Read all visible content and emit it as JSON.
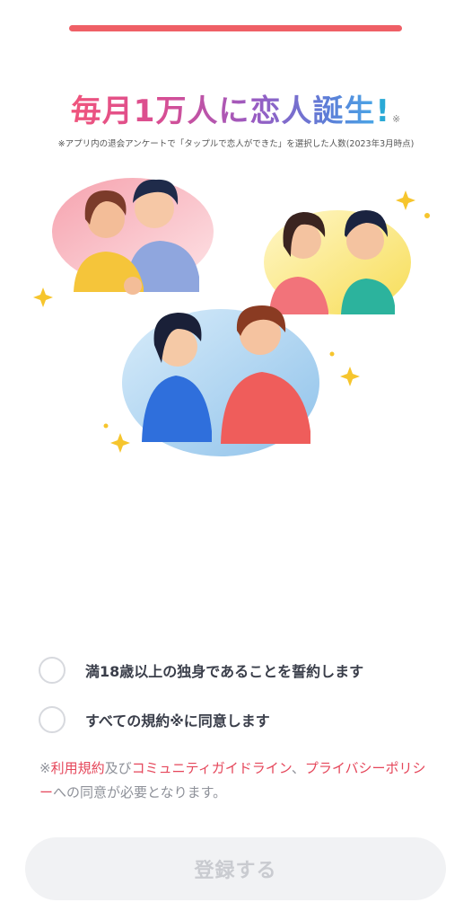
{
  "progress": {
    "fraction": 1.0,
    "color": "#ef5f66"
  },
  "headline": {
    "text": "毎月1万人に恋人誕生",
    "mark": "!",
    "note": "※"
  },
  "footnote": "※アプリ内の退会アンケートで「タップルで恋人ができた」を選択した人数(2023年3月時点)",
  "checkboxes": [
    {
      "label": "満18歳以上の独身であることを誓約します",
      "checked": false
    },
    {
      "label": "すべての規約※に同意します",
      "checked": false
    }
  ],
  "consent": {
    "prefix": "※",
    "terms_link": "利用規約",
    "conj": "及び",
    "guideline_link": "コミュニティガイドライン",
    "sep": "、",
    "privacy_link": "プライバシーポリシー",
    "suffix": "への同意が必要となります。"
  },
  "register_button": {
    "label": "登録する",
    "enabled": false
  },
  "colors": {
    "accent": "#ef5f66",
    "link": "#e5465a",
    "text_main": "#3a3e4a",
    "text_muted": "#8e9199",
    "button_disabled_bg": "#f1f2f4",
    "button_disabled_text": "#c9cbd0"
  },
  "illustration": {
    "alt": "",
    "scenes": [
      "couple-pink-bubble",
      "couple-yellow-bubble",
      "couple-blue-bubble"
    ]
  }
}
